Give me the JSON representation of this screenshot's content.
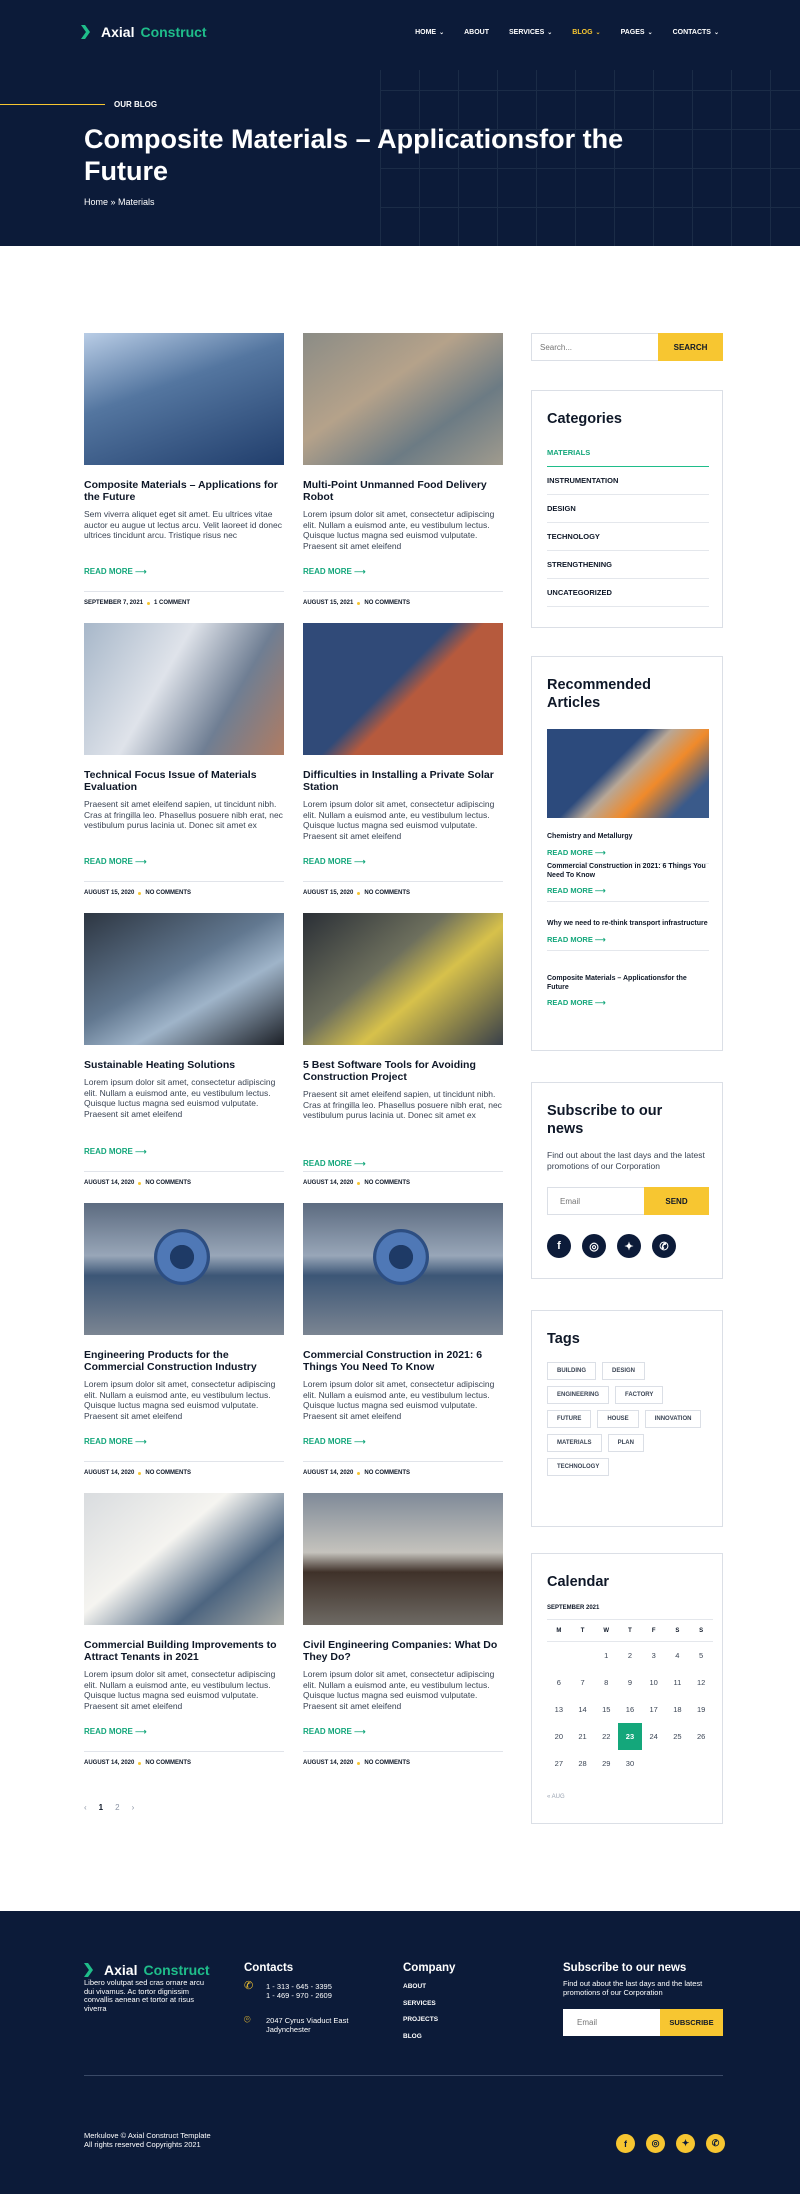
{
  "brand": {
    "name_a": "Axial",
    "name_b": "Construct"
  },
  "nav": [
    {
      "label": "HOME",
      "dropdown": true
    },
    {
      "label": "ABOUT",
      "dropdown": false
    },
    {
      "label": "SERVICES",
      "dropdown": true
    },
    {
      "label": "BLOG",
      "dropdown": true,
      "active": true
    },
    {
      "label": "PAGES",
      "dropdown": true
    },
    {
      "label": "CONTACTS",
      "dropdown": true
    }
  ],
  "hero": {
    "eyebrow": "OUR BLOG",
    "title": "Composite Materials – Applicationsfor the Future",
    "breadcrumb": "Home » Materials"
  },
  "posts": [
    {
      "title": "Composite Materials – Applications for the Future",
      "excerpt": "Sem viverra aliquet eget sit amet. Eu ultrices vitae auctor eu augue ut lectus arcu. Velit laoreet id donec ultrices tincidunt arcu. Tristique risus nec",
      "more": "READ MORE",
      "date": "SEPTEMBER 7, 2021",
      "comments": "1 COMMENT"
    },
    {
      "title": "Multi-Point Unmanned Food Delivery Robot",
      "excerpt": "Lorem ipsum dolor sit amet, consectetur adipiscing elit. Nullam a euismod ante, eu vestibulum lectus. Quisque luctus magna sed euismod vulputate. Praesent sit amet eleifend",
      "more": "READ MORE",
      "date": "AUGUST 15, 2021",
      "comments": "NO COMMENTS"
    },
    {
      "title": "Technical Focus Issue of Materials Evaluation",
      "excerpt": "Praesent sit amet eleifend sapien, ut tincidunt nibh. Cras at fringilla leo. Phasellus posuere nibh erat, nec vestibulum purus lacinia ut. Donec sit amet ex",
      "more": "READ MORE",
      "date": "AUGUST 15, 2020",
      "comments": "NO COMMENTS"
    },
    {
      "title": "Difficulties in Installing a Private Solar Station",
      "excerpt": "Lorem ipsum dolor sit amet, consectetur adipiscing elit. Nullam a euismod ante, eu vestibulum lectus. Quisque luctus magna sed euismod vulputate. Praesent sit amet eleifend",
      "more": "READ MORE",
      "date": "AUGUST 15, 2020",
      "comments": "NO COMMENTS"
    },
    {
      "title": "Sustainable Heating Solutions",
      "excerpt": "Lorem ipsum dolor sit amet, consectetur adipiscing elit. Nullam a euismod ante, eu vestibulum lectus. Quisque luctus magna sed euismod vulputate. Praesent sit amet eleifend",
      "more": "READ MORE",
      "date": "AUGUST 14, 2020",
      "comments": "NO COMMENTS"
    },
    {
      "title": "5 Best Software Tools for Avoiding Construction Project",
      "excerpt": "Praesent sit amet eleifend sapien, ut tincidunt nibh. Cras at fringilla leo. Phasellus posuere nibh erat, nec vestibulum purus lacinia ut. Donec sit amet ex",
      "more": "READ MORE",
      "date": "AUGUST 14, 2020",
      "comments": "NO COMMENTS"
    },
    {
      "title": "Engineering Products for the Commercial Construction Industry",
      "excerpt": "Lorem ipsum dolor sit amet, consectetur adipiscing elit. Nullam a euismod ante, eu vestibulum lectus. Quisque luctus magna sed euismod vulputate. Praesent sit amet eleifend",
      "more": "READ MORE",
      "date": "AUGUST 14, 2020",
      "comments": "NO COMMENTS"
    },
    {
      "title": "Commercial Construction in 2021: 6 Things You Need To Know",
      "excerpt": "Lorem ipsum dolor sit amet, consectetur adipiscing elit. Nullam a euismod ante, eu vestibulum lectus. Quisque luctus magna sed euismod vulputate. Praesent sit amet eleifend",
      "more": "READ MORE",
      "date": "AUGUST 14, 2020",
      "comments": "NO COMMENTS"
    },
    {
      "title": "Commercial Building Improvements to Attract Tenants in 2021",
      "excerpt": "Lorem ipsum dolor sit amet, consectetur adipiscing elit. Nullam a euismod ante, eu vestibulum lectus. Quisque luctus magna sed euismod vulputate. Praesent sit amet eleifend",
      "more": "READ MORE",
      "date": "AUGUST 14, 2020",
      "comments": "NO COMMENTS"
    },
    {
      "title": "Civil Engineering Companies: What Do They Do?",
      "excerpt": "Lorem ipsum dolor sit amet, consectetur adipiscing elit. Nullam a euismod ante, eu vestibulum lectus. Quisque luctus magna sed euismod vulputate. Praesent sit amet eleifend",
      "more": "READ MORE",
      "date": "AUGUST 14, 2020",
      "comments": "NO COMMENTS"
    }
  ],
  "pagination": {
    "prev": "‹",
    "pages": [
      "1",
      "2"
    ],
    "next": "›"
  },
  "search": {
    "placeholder": "Search...",
    "button": "SEARCH"
  },
  "categories": {
    "title": "Categories",
    "items": [
      "MATERIALS",
      "INSTRUMENTATION",
      "DESIGN",
      "TECHNOLOGY",
      "STRENGTHENING",
      "UNCATEGORIZED"
    ]
  },
  "recommended": {
    "title": "Recommended Articles",
    "items": [
      {
        "title": "Chemistry and Metallurgy",
        "more": "READ MORE"
      },
      {
        "title": "Commercial Construction in 2021: 6 Things You Need To Know",
        "more": "READ MORE"
      },
      {
        "title": "Why we need to re-think transport infrastructure",
        "more": "READ MORE"
      },
      {
        "title": "Composite Materials – Applicationsfor the Future",
        "more": "READ MORE"
      }
    ]
  },
  "subscribe": {
    "title": "Subscribe to our news",
    "text": "Find out about the last days and the latest promotions of our Corporation",
    "placeholder": "Email",
    "button": "SEND"
  },
  "socials": [
    "facebook-icon",
    "instagram-icon",
    "twitter-icon",
    "whatsapp-icon"
  ],
  "tags": {
    "title": "Tags",
    "items": [
      "BUILDING",
      "DESIGN",
      "ENGINEERING",
      "FACTORY",
      "FUTURE",
      "HOUSE",
      "INNOVATION",
      "MATERIALS",
      "PLAN",
      "TECHNOLOGY"
    ]
  },
  "calendar": {
    "title": "Calendar",
    "month": "SEPTEMBER 2021",
    "days": [
      "M",
      "T",
      "W",
      "T",
      "F",
      "S",
      "S"
    ],
    "weeks": [
      [
        "",
        "",
        "1",
        "2",
        "3",
        "4",
        "5"
      ],
      [
        "6",
        "7",
        "8",
        "9",
        "10",
        "11",
        "12"
      ],
      [
        "13",
        "14",
        "15",
        "16",
        "17",
        "18",
        "19"
      ],
      [
        "20",
        "21",
        "22",
        "23",
        "24",
        "25",
        "26"
      ],
      [
        "27",
        "28",
        "29",
        "30",
        "",
        "",
        ""
      ]
    ],
    "today": "23",
    "prev": "« AUG"
  },
  "footer": {
    "about": "Libero volutpat sed cras ornare arcu dui vivamus. Ac tortor dignissim convallis aenean et tortor at risus viverra",
    "contacts_title": "Contacts",
    "phone": "1 - 313 - 645 - 3395\n1 - 469 - 970 - 2609",
    "address": "2047 Cyrus Viaduct East\nJadynchester",
    "company_title": "Company",
    "links": [
      "ABOUT",
      "SERVICES",
      "PROJECTS",
      "BLOG"
    ],
    "sub_title": "Subscribe to our news",
    "sub_text": "Find out about the last days and the latest promotions of our Corporation",
    "sub_placeholder": "Email",
    "sub_button": "SUBSCRIBE",
    "copyright": "Merkulove © Axial Construct Template\nAll rights reserved Copyrights 2021"
  },
  "colors": {
    "navy": "#0c1b39",
    "accent_green": "#14a77b",
    "accent_yellow": "#f7c631"
  }
}
